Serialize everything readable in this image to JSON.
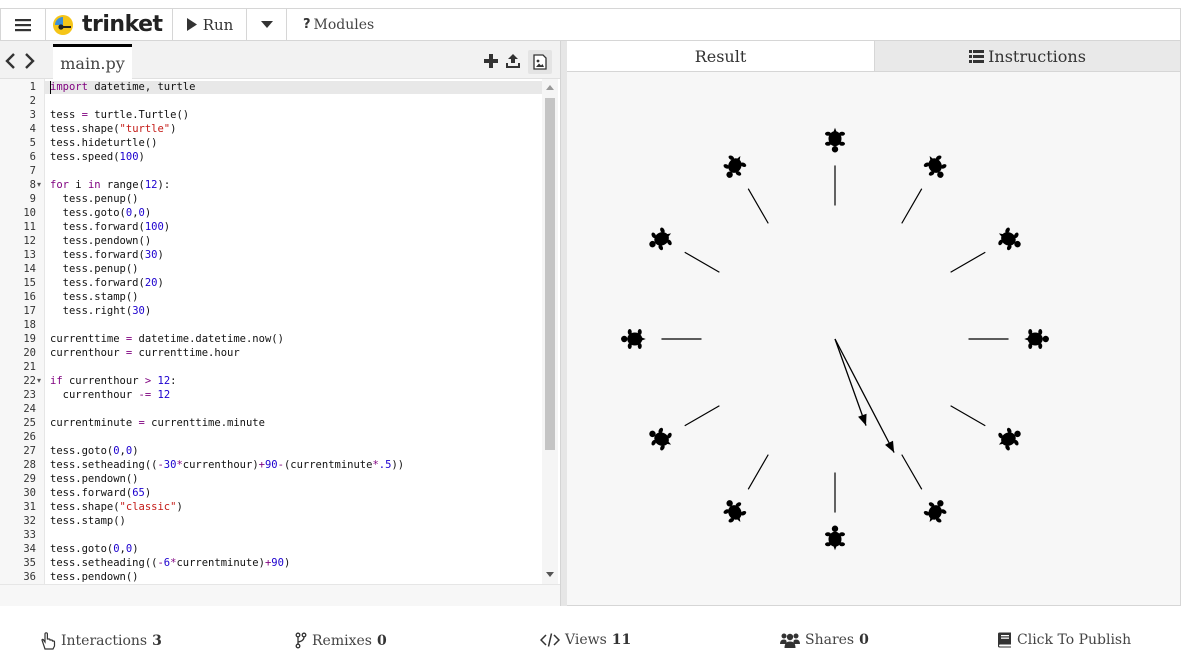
{
  "toolbar": {
    "brand": "trinket",
    "run_label": "Run",
    "modules_label": "Modules"
  },
  "editor": {
    "file_tab": "main.py",
    "lines": [
      {
        "n": "1",
        "code": "import datetime, turtle"
      },
      {
        "n": "2",
        "code": ""
      },
      {
        "n": "3",
        "code": "tess = turtle.Turtle()"
      },
      {
        "n": "4",
        "code": "tess.shape(\"turtle\")"
      },
      {
        "n": "5",
        "code": "tess.hideturtle()"
      },
      {
        "n": "6",
        "code": "tess.speed(100)"
      },
      {
        "n": "7",
        "code": ""
      },
      {
        "n": "8",
        "code": "for i in range(12):"
      },
      {
        "n": "9",
        "code": "  tess.penup()"
      },
      {
        "n": "10",
        "code": "  tess.goto(0,0)"
      },
      {
        "n": "11",
        "code": "  tess.forward(100)"
      },
      {
        "n": "12",
        "code": "  tess.pendown()"
      },
      {
        "n": "13",
        "code": "  tess.forward(30)"
      },
      {
        "n": "14",
        "code": "  tess.penup()"
      },
      {
        "n": "15",
        "code": "  tess.forward(20)"
      },
      {
        "n": "16",
        "code": "  tess.stamp()"
      },
      {
        "n": "17",
        "code": "  tess.right(30)"
      },
      {
        "n": "18",
        "code": ""
      },
      {
        "n": "19",
        "code": "currenttime = datetime.datetime.now()"
      },
      {
        "n": "20",
        "code": "currenthour = currenttime.hour"
      },
      {
        "n": "21",
        "code": ""
      },
      {
        "n": "22",
        "code": "if currenthour > 12:"
      },
      {
        "n": "23",
        "code": "  currenthour -= 12"
      },
      {
        "n": "24",
        "code": ""
      },
      {
        "n": "25",
        "code": "currentminute = currenttime.minute"
      },
      {
        "n": "26",
        "code": ""
      },
      {
        "n": "27",
        "code": "tess.goto(0,0)"
      },
      {
        "n": "28",
        "code": "tess.setheading((-30*currenthour)+90-(currentminute*.5))"
      },
      {
        "n": "29",
        "code": "tess.pendown()"
      },
      {
        "n": "30",
        "code": "tess.forward(65)"
      },
      {
        "n": "31",
        "code": "tess.shape(\"classic\")"
      },
      {
        "n": "32",
        "code": "tess.stamp()"
      },
      {
        "n": "33",
        "code": ""
      },
      {
        "n": "34",
        "code": "tess.goto(0,0)"
      },
      {
        "n": "35",
        "code": "tess.setheading((-6*currentminute)+90)"
      },
      {
        "n": "36",
        "code": "tess.pendown()"
      }
    ]
  },
  "result": {
    "result_tab": "Result",
    "instructions_tab": "Instructions"
  },
  "footer": {
    "interactions": {
      "label": "Interactions",
      "count": "3"
    },
    "remixes": {
      "label": "Remixes",
      "count": "0"
    },
    "views": {
      "label": "Views",
      "count": "11"
    },
    "shares": {
      "label": "Shares",
      "count": "0"
    },
    "publish": {
      "label": "Click To Publish"
    }
  },
  "colors": {
    "keyword": "#7f007f",
    "string": "#c41a16",
    "number": "#1c00cf",
    "accent": "#f5c518"
  },
  "icons": [
    "hamburger-icon",
    "trinket-key-icon",
    "play-icon",
    "caret-down-icon",
    "question-icon",
    "chevron-left-icon",
    "chevron-right-icon",
    "plus-icon",
    "upload-icon",
    "image-icon",
    "list-icon",
    "pointer-hand-icon",
    "fork-icon",
    "code-icon",
    "users-icon",
    "book-icon"
  ]
}
